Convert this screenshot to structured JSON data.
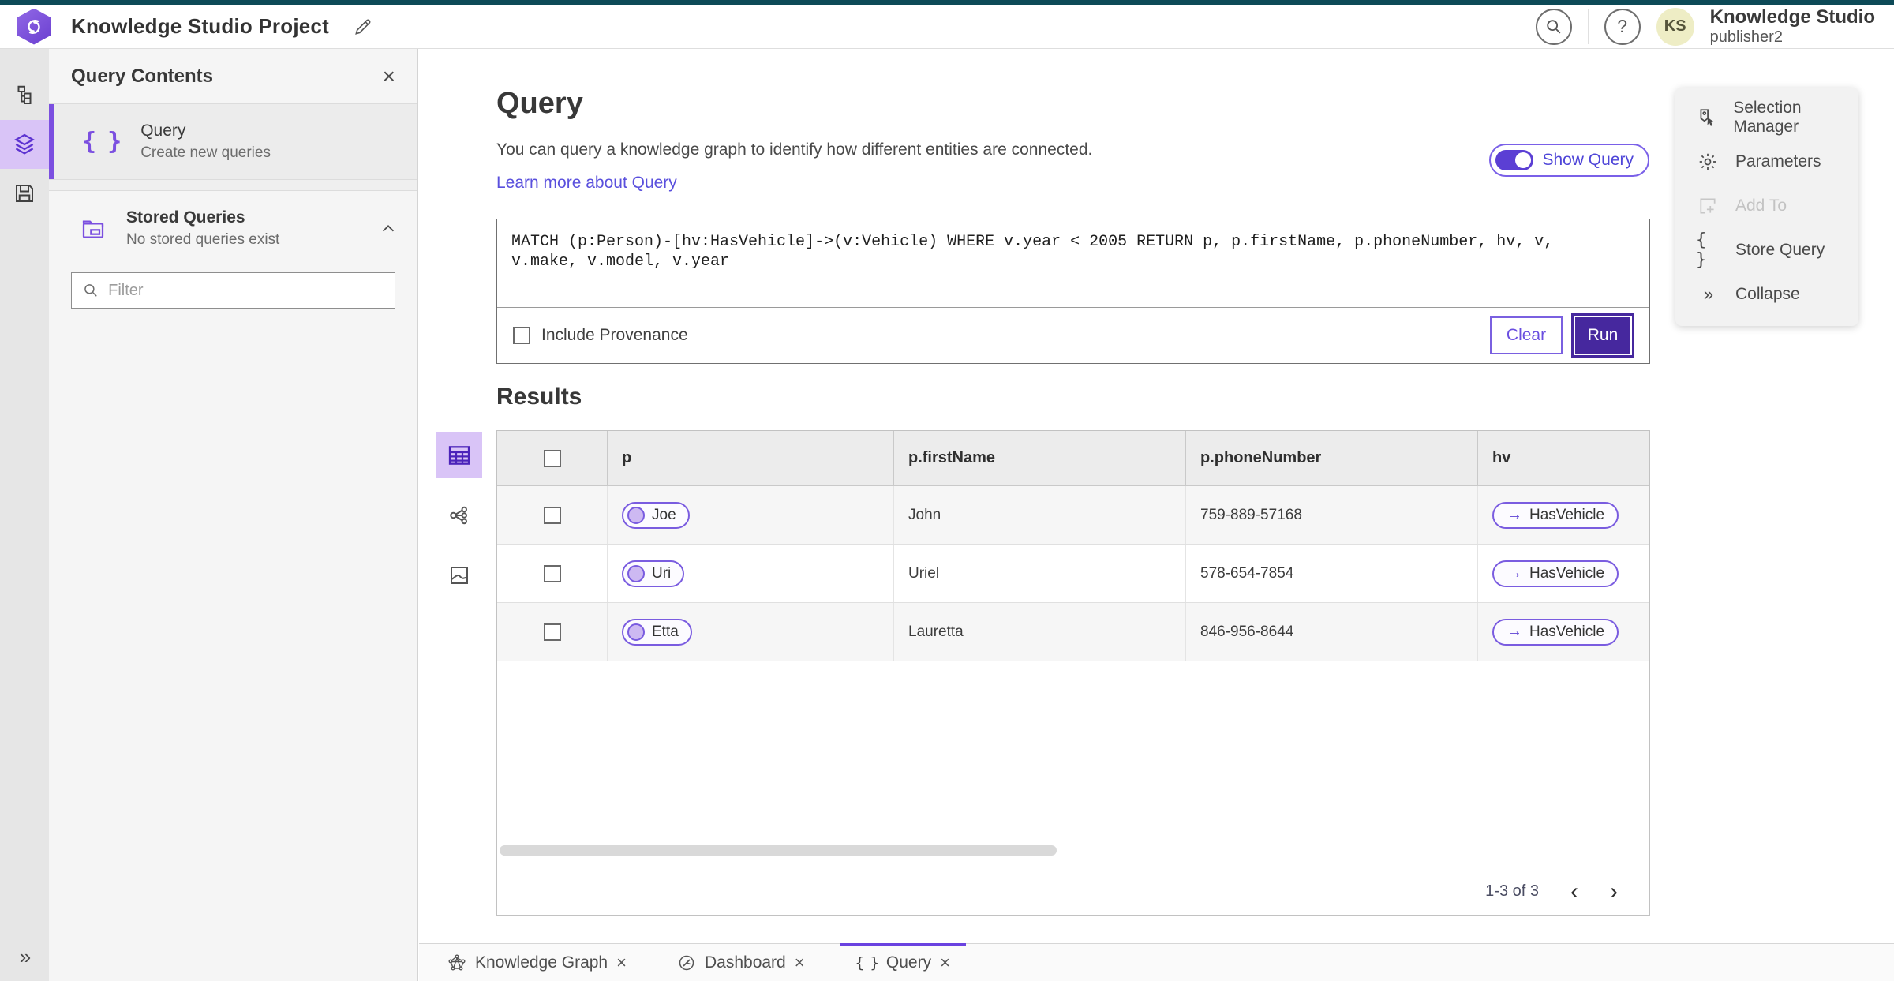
{
  "topbar": {
    "project_title": "Knowledge Studio Project",
    "app_name": "Knowledge Studio",
    "user_name": "publisher2",
    "avatar_initials": "KS",
    "help_glyph": "?"
  },
  "left_rail": {
    "expand_glyph": "»"
  },
  "query_contents": {
    "title": "Query Contents",
    "close_glyph": "×",
    "query_item": {
      "title": "Query",
      "subtitle": "Create new queries"
    },
    "stored_queries": {
      "title": "Stored Queries",
      "subtitle": "No stored queries exist"
    },
    "filter_placeholder": "Filter"
  },
  "query_panel": {
    "heading": "Query",
    "description": "You can query a knowledge graph to identify how different entities are connected.",
    "learn_more_label": "Learn more about Query",
    "show_query_label": "Show Query",
    "query_text": "MATCH (p:Person)-[hv:HasVehicle]->(v:Vehicle) WHERE v.year < 2005 RETURN p, p.firstName, p.phoneNumber, hv, v, v.make, v.model, v.year",
    "include_provenance_label": "Include Provenance",
    "clear_label": "Clear",
    "run_label": "Run"
  },
  "results": {
    "heading": "Results",
    "columns": [
      "p",
      "p.firstName",
      "p.phoneNumber",
      "hv"
    ],
    "rows": [
      {
        "p": "Joe",
        "firstName": "John",
        "phoneNumber": "759-889-57168",
        "hv": "HasVehicle"
      },
      {
        "p": "Uri",
        "firstName": "Uriel",
        "phoneNumber": "578-654-7854",
        "hv": "HasVehicle"
      },
      {
        "p": "Etta",
        "firstName": "Lauretta",
        "phoneNumber": "846-956-8644",
        "hv": "HasVehicle"
      }
    ],
    "relationship_arrow": "→",
    "pagination": {
      "range": "1-3 of 3",
      "prev_glyph": "‹",
      "next_glyph": "›"
    }
  },
  "right_panel": {
    "items": [
      {
        "label": "Selection Manager",
        "disabled": false
      },
      {
        "label": "Parameters",
        "disabled": false
      },
      {
        "label": "Add To",
        "disabled": true
      },
      {
        "label": "Store Query",
        "disabled": false
      },
      {
        "label": "Collapse",
        "disabled": false
      }
    ],
    "collapse_glyph": "»",
    "braces_glyph": "{ }"
  },
  "bottom_tabs": {
    "items": [
      {
        "label": "Knowledge Graph",
        "active": false
      },
      {
        "label": "Dashboard",
        "active": false
      },
      {
        "label": "Query",
        "active": true
      }
    ],
    "close_glyph": "×"
  },
  "colors": {
    "accent": "#6a4ee0",
    "accent_dark": "#46289e",
    "accent_light": "#d9c4f7",
    "top_strip": "#0d4a57"
  }
}
